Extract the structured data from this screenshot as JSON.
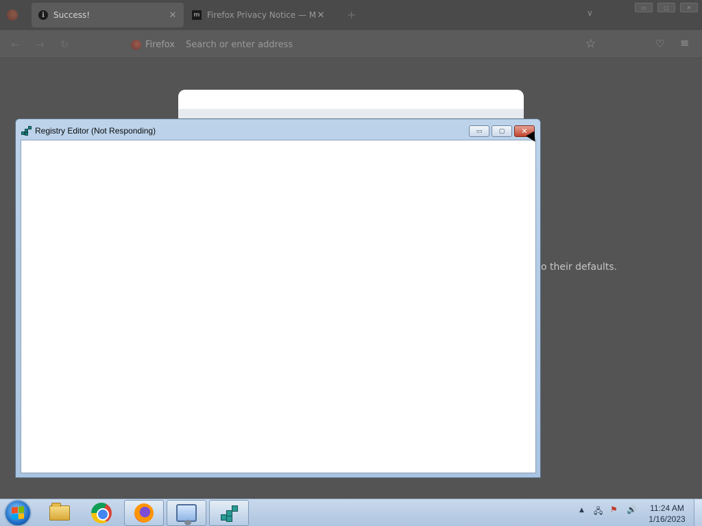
{
  "browser": {
    "tabs": [
      {
        "label": "Success!",
        "icon": "info-icon",
        "active": true
      },
      {
        "label": "Firefox Privacy Notice — Mozilla",
        "icon": "mozilla-m-icon",
        "active": false
      }
    ],
    "tab_close_glyph": "✕",
    "new_tab_glyph": "+",
    "url_brand": "Firefox",
    "url_placeholder": "Search or enter address",
    "content_partial_text": "o their defaults."
  },
  "registry_window": {
    "title": "Registry Editor (Not Responding)",
    "minimize_glyph": "▭",
    "maximize_glyph": "▢",
    "close_glyph": "✕"
  },
  "taskbar": {
    "pinned": [
      {
        "name": "windows-explorer",
        "active": false
      },
      {
        "name": "google-chrome",
        "active": false
      },
      {
        "name": "firefox",
        "active": true
      },
      {
        "name": "control-panel",
        "active": true
      },
      {
        "name": "registry-editor",
        "active": true
      }
    ],
    "tray": {
      "overflow_glyph": "▲"
    },
    "clock": {
      "time": "11:24 AM",
      "date": "1/16/2023"
    }
  }
}
